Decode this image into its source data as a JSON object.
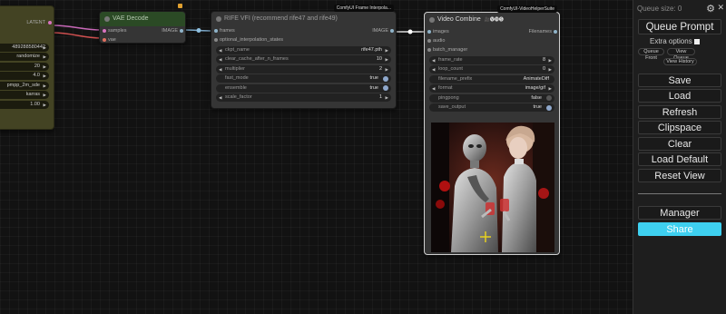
{
  "nodes": {
    "ksampler": {
      "output_label": "LATENT",
      "values": [
        "489288580442",
        "randomize",
        "20",
        "4.0",
        "pmpp_2m_sde",
        "karras",
        "1.00"
      ]
    },
    "vae_decode": {
      "title": "VAE Decode",
      "inputs": [
        "samples",
        "vae"
      ],
      "output": "IMAGE"
    },
    "rife": {
      "badge": "ComfyUI Frame Interpola...",
      "title": "RIFE VFI (recommend rife47 and rife49)",
      "input": "frames",
      "output": "IMAGE",
      "optional_label": "optional_interpolation_states",
      "widgets": [
        {
          "label": "ckpt_name",
          "value": "rife47.pth"
        },
        {
          "label": "clear_cache_after_n_frames",
          "value": "10"
        },
        {
          "label": "multiplier",
          "value": "2"
        },
        {
          "label": "fast_mode",
          "value": "true"
        },
        {
          "label": "ensemble",
          "value": "true"
        },
        {
          "label": "scale_factor",
          "value": "1"
        }
      ]
    },
    "video_combine": {
      "badge": "ComfyUI-VideoHelperSuite",
      "title": "Video Combine",
      "title_icons": "🎥🅥🅗🅢",
      "inputs": [
        "images",
        "audio",
        "batch_manager"
      ],
      "output": "Filenames",
      "widgets": [
        {
          "label": "frame_rate",
          "value": "8"
        },
        {
          "label": "loop_count",
          "value": "0"
        },
        {
          "label": "filename_prefix",
          "value": "AnimateDiff"
        },
        {
          "label": "format",
          "value": "image/gif"
        },
        {
          "label": "pingpong",
          "value": "false"
        },
        {
          "label": "save_output",
          "value": "true"
        }
      ]
    }
  },
  "panel": {
    "queue_size": "Queue size: 0",
    "queue_prompt": "Queue Prompt",
    "extra_options": "Extra options",
    "small_buttons": [
      "Queue Front",
      "View Queue",
      "View History"
    ],
    "buttons": [
      "Save",
      "Load",
      "Refresh",
      "Clipspace",
      "Clear",
      "Load Default",
      "Reset View"
    ],
    "manager": "Manager",
    "share": "Share"
  },
  "colors": {
    "accent_share": "#3ed0f0",
    "node_bg": "#353535",
    "ksampler_bg": "#434323",
    "vae_title": "#2b4a25"
  }
}
